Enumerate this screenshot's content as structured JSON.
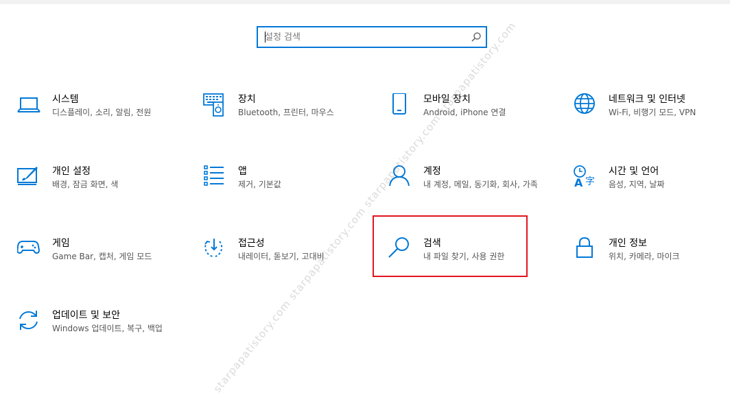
{
  "search": {
    "placeholder": "설정 검색",
    "icon": "search-icon"
  },
  "accent_color": "#0078d7",
  "highlight_color": "#e3131e",
  "watermark": "starpapatistory.com    starpapatistory.com    starpapatistory.com    starpapatistory.com",
  "tiles": [
    {
      "id": "system",
      "title": "시스템",
      "desc": "디스플레이, 소리, 알림, 전원",
      "icon": "laptop-icon"
    },
    {
      "id": "devices",
      "title": "장치",
      "desc": "Bluetooth, 프린터, 마우스",
      "icon": "devices-icon"
    },
    {
      "id": "phone",
      "title": "모바일 장치",
      "desc": "Android, iPhone 연결",
      "icon": "phone-icon"
    },
    {
      "id": "network",
      "title": "네트워크 및 인터넷",
      "desc": "Wi-Fi, 비행기 모드, VPN",
      "icon": "globe-icon"
    },
    {
      "id": "personalization",
      "title": "개인 설정",
      "desc": "배경, 잠금 화면, 색",
      "icon": "personalization-icon"
    },
    {
      "id": "apps",
      "title": "앱",
      "desc": "제거, 기본값",
      "icon": "apps-list-icon"
    },
    {
      "id": "accounts",
      "title": "계정",
      "desc": "내 계정, 메일, 동기화, 회사, 가족",
      "icon": "person-icon"
    },
    {
      "id": "time-language",
      "title": "시간 및 언어",
      "desc": "음성, 지역, 날짜",
      "icon": "time-language-icon"
    },
    {
      "id": "gaming",
      "title": "게임",
      "desc": "Game Bar, 캡처, 게임 모드",
      "icon": "gamepad-icon"
    },
    {
      "id": "ease-of-access",
      "title": "접근성",
      "desc": "내레이터, 돋보기, 고대비",
      "icon": "ease-of-access-icon"
    },
    {
      "id": "search",
      "title": "검색",
      "desc": "내 파일 찾기, 사용 권한",
      "icon": "magnifier-icon"
    },
    {
      "id": "privacy",
      "title": "개인 정보",
      "desc": "위치, 카메라, 마이크",
      "icon": "lock-icon"
    },
    {
      "id": "update-security",
      "title": "업데이트 및 보안",
      "desc": "Windows 업데이트, 복구, 백업",
      "icon": "sync-icon"
    }
  ]
}
